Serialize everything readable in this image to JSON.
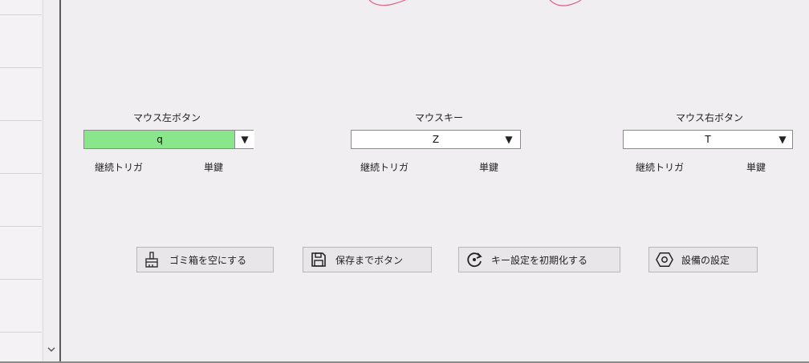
{
  "left": {
    "rows": 7,
    "scroll_down_icon": "chevron-down-icon"
  },
  "mouse_left": {
    "label": "マウス左ボタン",
    "value": "q",
    "trigger": "継続トリガ",
    "mode": "単鍵",
    "highlight_color": "#8ae68a"
  },
  "mouse_key": {
    "label": "マウスキー",
    "value": "Z",
    "trigger": "継続トリガ",
    "mode": "単鍵"
  },
  "mouse_right": {
    "label": "マウス右ボタン",
    "value": "T",
    "trigger": "継続トリガ",
    "mode": "単鍵"
  },
  "buttons": {
    "trash": {
      "label": "ゴミ箱を空にする",
      "icon": "brush-icon"
    },
    "save": {
      "label": "保存までボタン",
      "icon": "save-icon"
    },
    "reset": {
      "label": "キー設定を初期化する",
      "icon": "reset-icon"
    },
    "settings": {
      "label": "設備の設定",
      "icon": "gear-icon"
    }
  },
  "decor_color": "#e06080"
}
